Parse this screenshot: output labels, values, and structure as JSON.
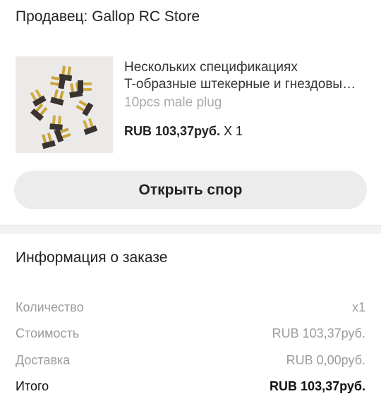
{
  "seller": {
    "label": "Продавец: Gallop RC Store"
  },
  "product": {
    "title": "Нескольких спецификациях",
    "title_line2": "T-образные штекерные и гнездовы…",
    "variant": "10pcs male plug",
    "price": "RUB 103,37руб.",
    "quantity": "X 1"
  },
  "actions": {
    "open_dispute": "Открыть спор"
  },
  "order_info": {
    "title": "Информация о заказе",
    "rows": [
      {
        "label": "Количество",
        "value": "x1"
      },
      {
        "label": "Стоимость",
        "value": "RUB 103,37руб."
      },
      {
        "label": "Доставка",
        "value": "RUB 0,00руб."
      },
      {
        "label": "Итого",
        "value": "RUB 103,37руб."
      }
    ]
  },
  "colors": {
    "button_bg": "#ececec",
    "muted_text": "#9c9c9c",
    "divider": "#f2f2f2"
  }
}
